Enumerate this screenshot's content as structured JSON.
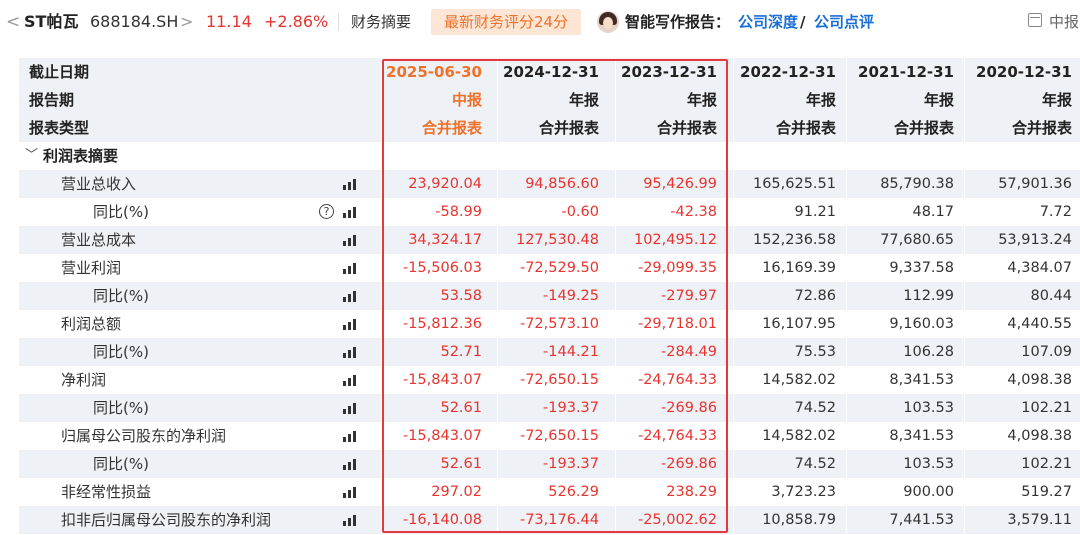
{
  "header": {
    "back": "<",
    "stock_name": "ST帕瓦",
    "stock_code": "688184.SH",
    "chevron": ">",
    "price": "11.14",
    "change": "+2.86%",
    "financial_summary": "财务摘要",
    "score_badge": "最新财务评分24分",
    "ai_label": "智能写作报告：",
    "link_company_depth": "公司深度",
    "slash": "/",
    "link_company_review": "公司点评",
    "lang_toggle": "中报"
  },
  "table": {
    "header_labels": [
      "截止日期",
      "报告期",
      "报表类型"
    ],
    "columns": [
      {
        "date": "2025-06-30",
        "period": "中报",
        "type": "合并报表"
      },
      {
        "date": "2024-12-31",
        "period": "年报",
        "type": "合并报表"
      },
      {
        "date": "2023-12-31",
        "period": "年报",
        "type": "合并报表"
      },
      {
        "date": "2022-12-31",
        "period": "年报",
        "type": "合并报表"
      },
      {
        "date": "2021-12-31",
        "period": "年报",
        "type": "合并报表"
      },
      {
        "date": "2020-12-31",
        "period": "年报",
        "type": "合并报表"
      }
    ],
    "section_title": "利润表摘要",
    "section_caret": "﹀",
    "rows": [
      {
        "label": "营业总收入",
        "values": [
          "23,920.04",
          "94,856.60",
          "95,426.99",
          "165,625.51",
          "85,790.38",
          "57,901.36"
        ]
      },
      {
        "label": "同比(%)",
        "help": "?",
        "values": [
          "-58.99",
          "-0.60",
          "-42.38",
          "91.21",
          "48.17",
          "7.72"
        ]
      },
      {
        "label": "营业总成本",
        "values": [
          "34,324.17",
          "127,530.48",
          "102,495.12",
          "152,236.58",
          "77,680.65",
          "53,913.24"
        ]
      },
      {
        "label": "营业利润",
        "values": [
          "-15,506.03",
          "-72,529.50",
          "-29,099.35",
          "16,169.39",
          "9,337.58",
          "4,384.07"
        ]
      },
      {
        "label": "同比(%)",
        "values": [
          "53.58",
          "-149.25",
          "-279.97",
          "72.86",
          "112.99",
          "80.44"
        ]
      },
      {
        "label": "利润总额",
        "values": [
          "-15,812.36",
          "-72,573.10",
          "-29,718.01",
          "16,107.95",
          "9,160.03",
          "4,440.55"
        ]
      },
      {
        "label": "同比(%)",
        "values": [
          "52.71",
          "-144.21",
          "-284.49",
          "75.53",
          "106.28",
          "107.09"
        ]
      },
      {
        "label": "净利润",
        "values": [
          "-15,843.07",
          "-72,650.15",
          "-24,764.33",
          "14,582.02",
          "8,341.53",
          "4,098.38"
        ]
      },
      {
        "label": "同比(%)",
        "values": [
          "52.61",
          "-193.37",
          "-269.86",
          "74.52",
          "103.53",
          "102.21"
        ]
      },
      {
        "label": "归属母公司股东的净利润",
        "values": [
          "-15,843.07",
          "-72,650.15",
          "-24,764.33",
          "14,582.02",
          "8,341.53",
          "4,098.38"
        ]
      },
      {
        "label": "同比(%)",
        "values": [
          "52.61",
          "-193.37",
          "-269.86",
          "74.52",
          "103.53",
          "102.21"
        ]
      },
      {
        "label": "非经常性损益",
        "values": [
          "297.02",
          "526.29",
          "238.29",
          "3,723.23",
          "900.00",
          "519.27"
        ]
      },
      {
        "label": "扣非后归属母公司股东的净利润",
        "values": [
          "-16,140.08",
          "-73,176.44",
          "-25,002.62",
          "10,858.79",
          "7,441.53",
          "3,579.11"
        ]
      }
    ]
  },
  "colors": {
    "up_red": "#e8332f",
    "highlight_orange": "#f0712a",
    "link_blue": "#1a6fd6",
    "stripe": "#eef1f5",
    "annotation_box": "#e4393c"
  }
}
